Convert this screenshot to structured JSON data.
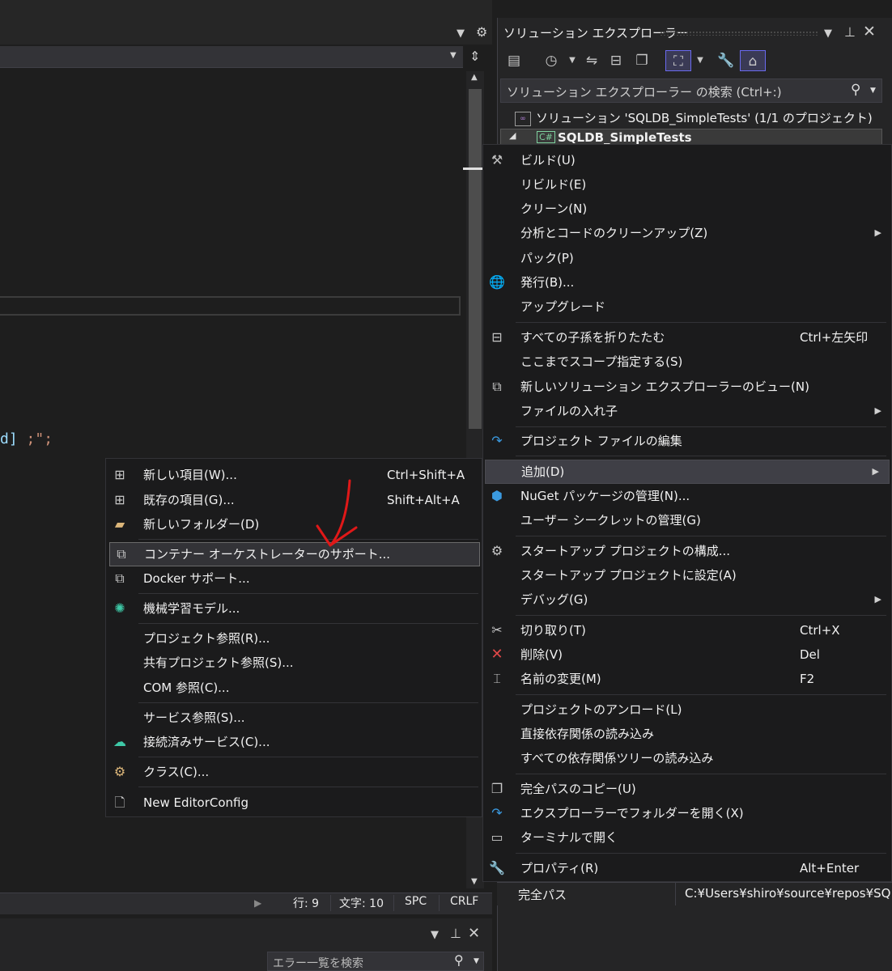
{
  "editor": {
    "code_tail_brace": "d]",
    "code_tail_rest": " ;\";",
    "status": {
      "line": "行: 9",
      "char": "文字: 10",
      "spc": "SPC",
      "crlf": "CRLF"
    }
  },
  "bottom_panel": {
    "search_placeholder": "エラー一覧を検索"
  },
  "solution_explorer": {
    "title": "ソリューション エクスプローラー",
    "search_placeholder": "ソリューション エクスプローラー の検索 (Ctrl+:)",
    "solution_label": "ソリューション 'SQLDB_SimpleTests' (1/1 のプロジェクト)",
    "project_label": "SQLDB_SimpleTests",
    "project_icon": "C#",
    "property_name": "完全パス",
    "property_value": "C:¥Users¥shiro¥source¥repos¥SQ"
  },
  "context_menu": {
    "items": [
      {
        "label": "ビルド(U)",
        "icon": "build-icon"
      },
      {
        "label": "リビルド(E)"
      },
      {
        "label": "クリーン(N)"
      },
      {
        "label": "分析とコードのクリーンアップ(Z)",
        "submenu": true
      },
      {
        "label": "パック(P)"
      },
      {
        "label": "発行(B)...",
        "icon": "globe-icon"
      },
      {
        "label": "アップグレード"
      },
      {
        "label": "すべての子孫を折りたたむ",
        "shortcut": "Ctrl+左矢印",
        "icon": "collapse-icon"
      },
      {
        "label": "ここまでスコープ指定する(S)"
      },
      {
        "label": "新しいソリューション エクスプローラーのビュー(N)",
        "icon": "new-view-icon"
      },
      {
        "label": "ファイルの入れ子",
        "submenu": true
      },
      {
        "label": "プロジェクト ファイルの編集",
        "icon": "redo-icon"
      },
      {
        "label": "追加(D)",
        "submenu": true
      },
      {
        "label": "NuGet パッケージの管理(N)...",
        "icon": "nuget-icon"
      },
      {
        "label": "ユーザー シークレットの管理(G)"
      },
      {
        "label": "スタートアップ プロジェクトの構成...",
        "icon": "gear-icon"
      },
      {
        "label": "スタートアップ プロジェクトに設定(A)"
      },
      {
        "label": "デバッグ(G)",
        "submenu": true
      },
      {
        "label": "切り取り(T)",
        "shortcut": "Ctrl+X",
        "icon": "scissors-icon"
      },
      {
        "label": "削除(V)",
        "shortcut": "Del",
        "icon": "delete-x-icon"
      },
      {
        "label": "名前の変更(M)",
        "shortcut": "F2",
        "icon": "rename-icon"
      },
      {
        "label": "プロジェクトのアンロード(L)"
      },
      {
        "label": "直接依存関係の読み込み"
      },
      {
        "label": "すべての依存関係ツリーの読み込み"
      },
      {
        "label": "完全パスのコピー(U)",
        "icon": "copy-icon"
      },
      {
        "label": "エクスプローラーでフォルダーを開く(X)",
        "icon": "redo-icon"
      },
      {
        "label": "ターミナルで開く",
        "icon": "terminal-icon"
      },
      {
        "label": "プロパティ(R)",
        "shortcut": "Alt+Enter",
        "icon": "wrench-icon"
      }
    ]
  },
  "add_submenu": {
    "items": [
      {
        "label": "新しい項目(W)...",
        "shortcut": "Ctrl+Shift+A",
        "icon": "new-item-icon"
      },
      {
        "label": "既存の項目(G)...",
        "shortcut": "Shift+Alt+A",
        "icon": "existing-item-icon"
      },
      {
        "label": "新しいフォルダー(D)",
        "icon": "new-folder-icon"
      },
      {
        "label": "コンテナー オーケストレーターのサポート...",
        "icon": "container-icon"
      },
      {
        "label": "Docker サポート...",
        "icon": "docker-icon"
      },
      {
        "label": "機械学習モデル...",
        "icon": "ml-icon"
      },
      {
        "label": "プロジェクト参照(R)..."
      },
      {
        "label": "共有プロジェクト参照(S)..."
      },
      {
        "label": "COM 参照(C)..."
      },
      {
        "label": "サービス参照(S)..."
      },
      {
        "label": "接続済みサービス(C)...",
        "icon": "connected-service-icon"
      },
      {
        "label": "クラス(C)...",
        "icon": "class-icon"
      },
      {
        "label": "New EditorConfig",
        "icon": "file-icon"
      }
    ]
  },
  "colors": {
    "background": "#1e1e1e",
    "menu_bg": "#1b1b1c",
    "highlight": "#3f3f46",
    "annotation": "#e01818"
  }
}
